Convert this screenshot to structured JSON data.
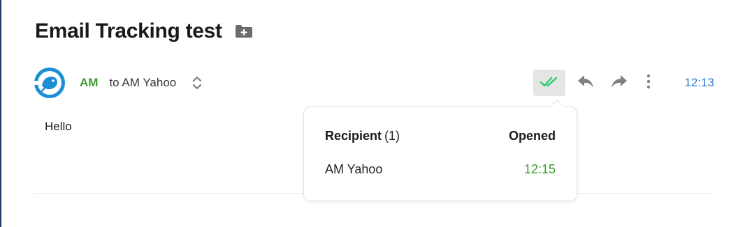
{
  "message": {
    "subject": "Email Tracking test",
    "sender_initials": "AM",
    "to_text": "to AM Yahoo",
    "time": "12:13",
    "body": "Hello"
  },
  "tracking_popover": {
    "recipient_label": "Recipient",
    "recipient_count": "(1)",
    "opened_label": "Opened",
    "rows": [
      {
        "recipient": "AM Yahoo",
        "opened_time": "12:15"
      }
    ]
  },
  "icons": {
    "folder": "folder-add-icon",
    "avatar": "mailbird-logo-icon",
    "expand": "chevron-up-down-icon",
    "tracking": "double-check-icon",
    "reply": "reply-icon",
    "forward": "forward-icon",
    "more": "more-vertical-icon"
  },
  "colors": {
    "sender": "#3b9a2e",
    "time": "#2f7bd1",
    "opened": "#3b9a2e",
    "check": "#2ecc71",
    "active_button_bg": "#e5e5e5"
  }
}
